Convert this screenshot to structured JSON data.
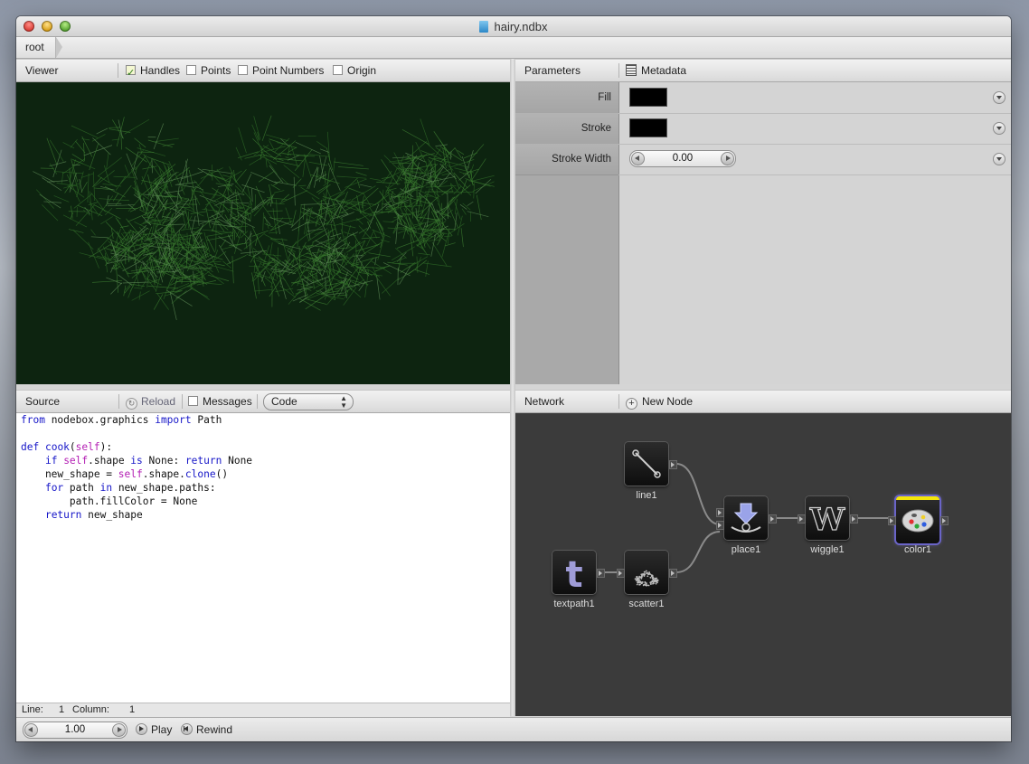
{
  "window": {
    "title": "hairy.ndbx"
  },
  "breadcrumb": {
    "root": "root"
  },
  "viewer": {
    "title": "Viewer",
    "options": [
      {
        "label": "Handles",
        "checked": true
      },
      {
        "label": "Points",
        "checked": false
      },
      {
        "label": "Point Numbers",
        "checked": false
      },
      {
        "label": "Origin",
        "checked": false
      }
    ],
    "canvas_bg": "#0d2410",
    "hair_color": "#3e7d31"
  },
  "parameters": {
    "title": "Parameters",
    "metadata_label": "Metadata",
    "rows": [
      {
        "label": "Fill",
        "color": "#000000"
      },
      {
        "label": "Stroke",
        "color": "#000000"
      },
      {
        "label": "Stroke Width",
        "value": "0.00"
      }
    ]
  },
  "source": {
    "title": "Source",
    "reload_label": "Reload",
    "messages_label": "Messages",
    "mode_select": "Code",
    "code_lines": [
      "from nodebox.graphics import Path",
      "",
      "def cook(self):",
      "    if self.shape is None: return None",
      "    new_shape = self.shape.clone()",
      "    for path in new_shape.paths:",
      "        path.fillColor = None",
      "    return new_shape"
    ],
    "status": {
      "line_label": "Line:",
      "line": "1",
      "column_label": "Column:",
      "column": "1"
    }
  },
  "network": {
    "title": "Network",
    "new_node_label": "New Node",
    "nodes": [
      {
        "id": "line1",
        "label": "line1",
        "icon": "line-icon"
      },
      {
        "id": "place1",
        "label": "place1",
        "icon": "place-icon"
      },
      {
        "id": "wiggle1",
        "label": "wiggle1",
        "icon": "wiggle-icon"
      },
      {
        "id": "color1",
        "label": "color1",
        "icon": "palette-icon",
        "selected": true
      },
      {
        "id": "textpath1",
        "label": "textpath1",
        "icon": "textpath-icon"
      },
      {
        "id": "scatter1",
        "label": "scatter1",
        "icon": "scatter-icon"
      }
    ],
    "canvas_bg": "#3b3b3b",
    "accent": "#6a64c8"
  },
  "playback": {
    "frame": "1.00",
    "play_label": "Play",
    "rewind_label": "Rewind"
  }
}
